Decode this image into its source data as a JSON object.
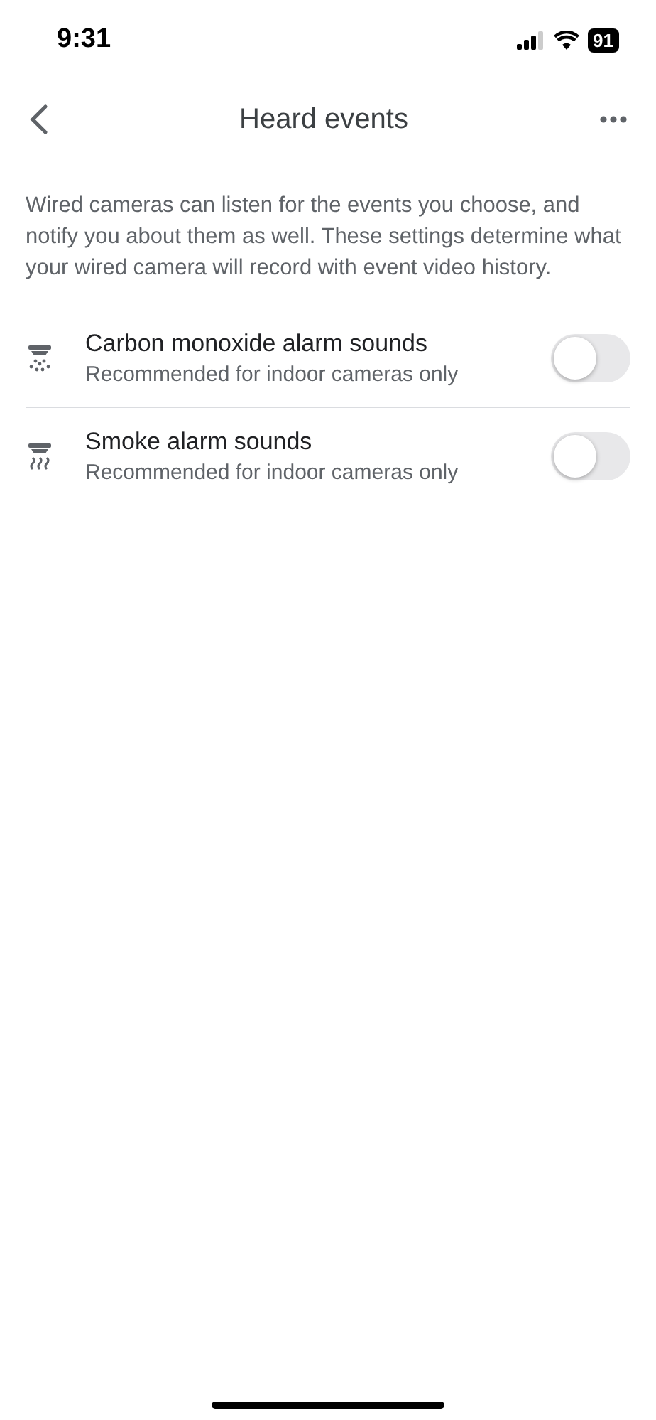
{
  "status_bar": {
    "time": "9:31",
    "battery": "91"
  },
  "header": {
    "title": "Heard events"
  },
  "description": "Wired cameras can listen for the events you choose, and notify you about them as well. These settings determine what your wired camera will record with event video history.",
  "settings": [
    {
      "kind": "co",
      "title": "Carbon monoxide alarm sounds",
      "subtitle": "Recommended for indoor cameras only",
      "on": false
    },
    {
      "kind": "smoke",
      "title": "Smoke alarm sounds",
      "subtitle": "Recommended for indoor cameras only",
      "on": false
    }
  ]
}
